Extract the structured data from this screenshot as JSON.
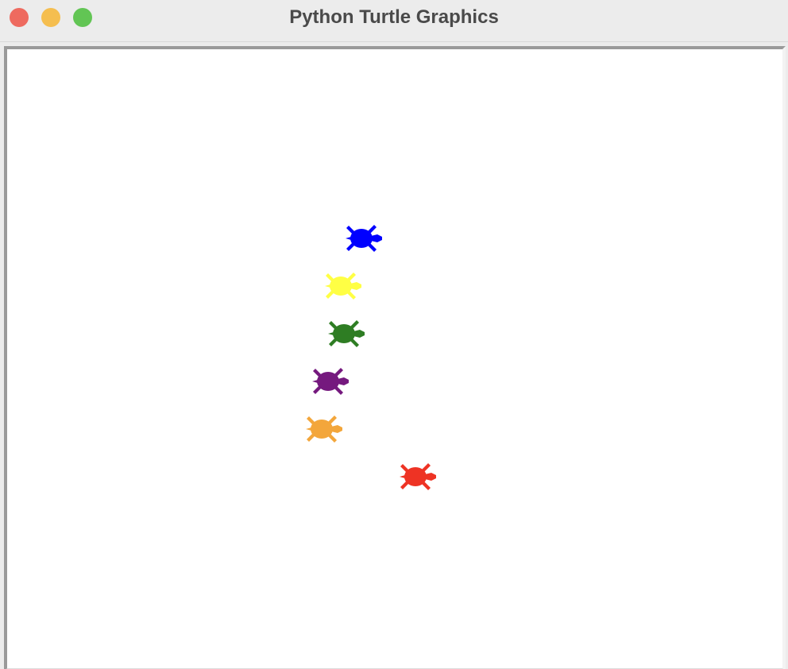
{
  "window": {
    "title": "Python Turtle Graphics",
    "controls": {
      "close_color": "#ee6a5f",
      "minimize_color": "#f5be4f",
      "zoom_color": "#62c554"
    }
  },
  "canvas": {
    "background": "#ffffff",
    "turtles": [
      {
        "name": "blue-turtle",
        "color": "#0000ff"
      },
      {
        "name": "yellow-turtle",
        "color": "#ffff44"
      },
      {
        "name": "green-turtle",
        "color": "#2e7d23"
      },
      {
        "name": "purple-turtle",
        "color": "#75197e"
      },
      {
        "name": "orange-turtle",
        "color": "#f3a63b"
      },
      {
        "name": "red-turtle",
        "color": "#ee3324"
      }
    ]
  }
}
